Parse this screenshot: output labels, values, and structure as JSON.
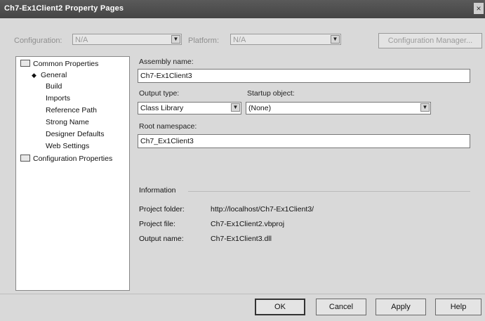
{
  "window": {
    "title": "Ch7-Ex1Client2 Property Pages",
    "close_glyph": "×"
  },
  "config_bar": {
    "configuration_label": "Configuration:",
    "configuration_value": "N/A",
    "platform_label": "Platform:",
    "platform_value": "N/A",
    "config_manager_label": "Configuration Manager..."
  },
  "tree": {
    "common_properties": "Common Properties",
    "items": [
      "General",
      "Build",
      "Imports",
      "Reference Path",
      "Strong Name",
      "Designer Defaults",
      "Web Settings"
    ],
    "selected_index": 0,
    "configuration_properties": "Configuration Properties"
  },
  "form": {
    "assembly_name_label": "Assembly name:",
    "assembly_name_value": "Ch7-Ex1Client3",
    "output_type_label": "Output type:",
    "output_type_value": "Class Library",
    "startup_object_label": "Startup object:",
    "startup_object_value": "(None)",
    "root_namespace_label": "Root namespace:",
    "root_namespace_value": "Ch7_Ex1Client3"
  },
  "information": {
    "heading": "Information",
    "rows": [
      {
        "label": "Project folder:",
        "value": "http://localhost/Ch7-Ex1Client3/"
      },
      {
        "label": "Project file:",
        "value": "Ch7-Ex1Client2.vbproj"
      },
      {
        "label": "Output name:",
        "value": "Ch7-Ex1Client3.dll"
      }
    ]
  },
  "buttons": {
    "ok": "OK",
    "cancel": "Cancel",
    "apply": "Apply",
    "help": "Help"
  }
}
